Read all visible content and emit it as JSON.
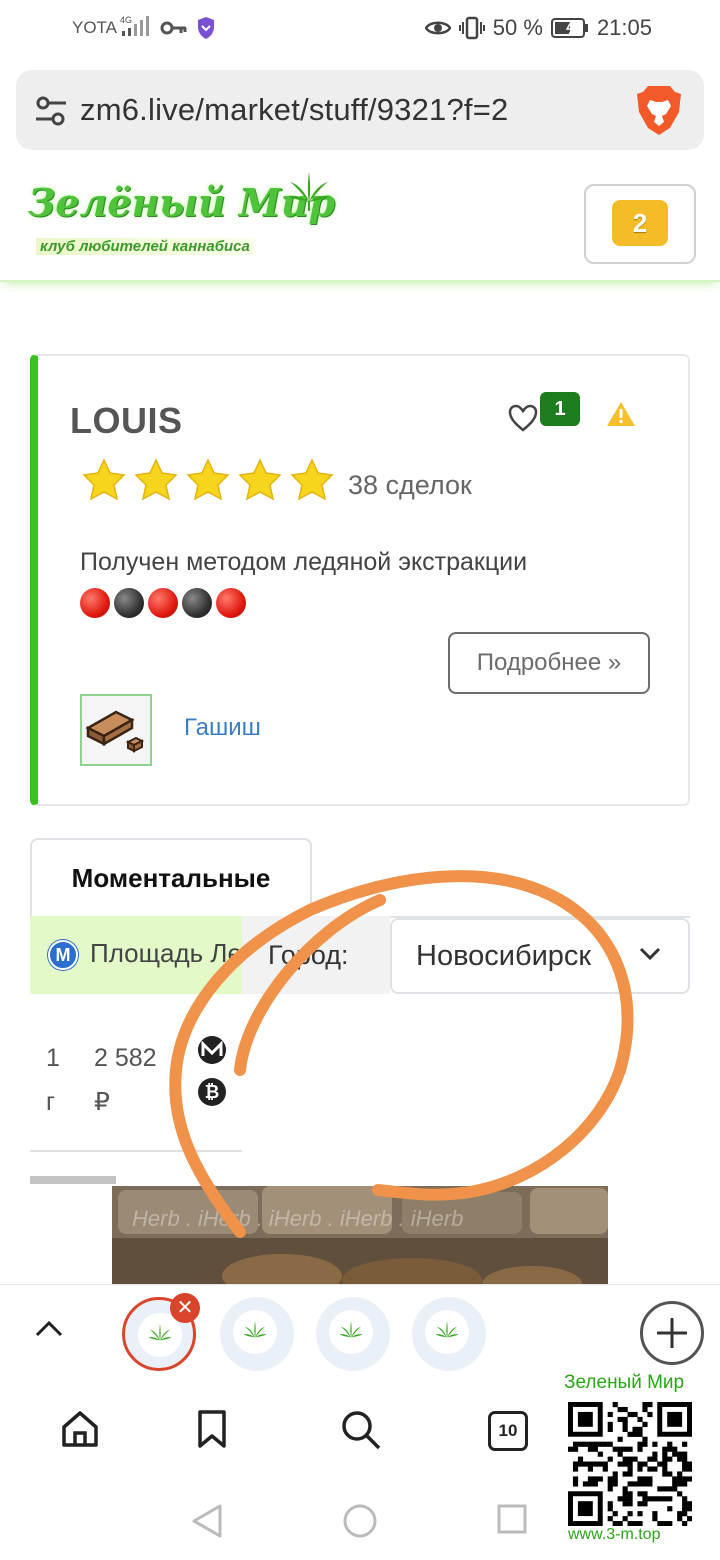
{
  "status_bar": {
    "carrier": "YOTA",
    "network": "4G",
    "battery_percent": "50 %",
    "time": "21:05"
  },
  "browser": {
    "url": "zm6.live/market/stuff/9321?f=2",
    "open_tabs_count": "10"
  },
  "site": {
    "logo_title": "Зелёный Мир",
    "logo_subtitle": "клуб любителей каннабиса",
    "cart_count": "2"
  },
  "seller": {
    "name": "LOUIS",
    "likes": "1",
    "rating_stars": 5,
    "deals": "38 сделок",
    "description": "Получен методом ледяной экстракции",
    "more_button": "Подробнее »",
    "category": "Гашиш"
  },
  "tabs": {
    "active": "Моментальные"
  },
  "location": {
    "station": "Площадь Ленина",
    "city_label": "Город:",
    "city_value": "Новосибирск"
  },
  "offer": {
    "qty_value": "1",
    "qty_unit": "г",
    "price_value": "2 582",
    "price_currency": "₽"
  },
  "photo": {
    "watermark": "Herb . iHerb . iHerb . iHerb . iHerb"
  },
  "watermark_qr": {
    "title": "Зеленый Мир",
    "site": "www.3-m.top"
  },
  "colors": {
    "accent_green": "#3cbf23",
    "badge_yellow": "#f4bd28",
    "like_green": "#1d7d1d",
    "link_blue": "#3a7fc4",
    "annotation_orange": "#f0924a"
  }
}
